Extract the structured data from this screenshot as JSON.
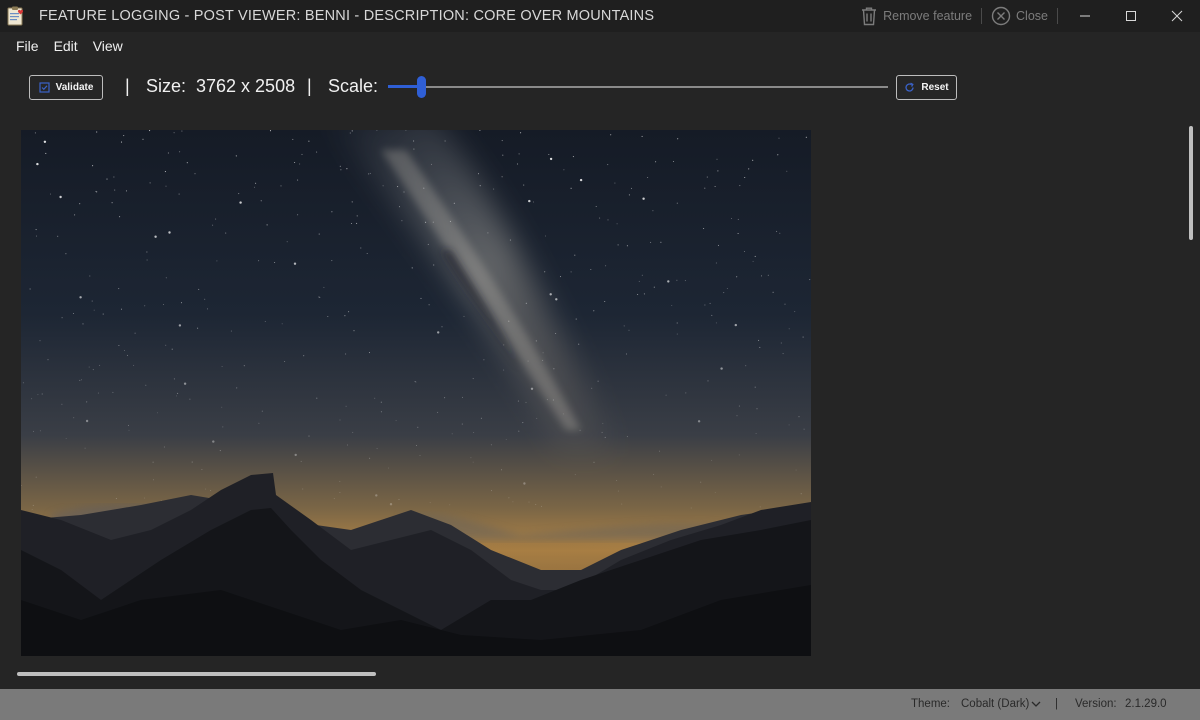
{
  "window": {
    "title": "FEATURE LOGGING - POST VIEWER: BENNI - DESCRIPTION: CORE OVER MOUNTAINS",
    "actions": {
      "remove_feature": "Remove feature",
      "close": "Close"
    }
  },
  "menu": {
    "file": "File",
    "edit": "Edit",
    "view": "View"
  },
  "toolbar": {
    "validate_label": "Validate",
    "separator": "|",
    "size_label": "Size:",
    "size_value": "3762 x 2508",
    "scale_label": "Scale:",
    "scale_slider_fraction": 0.065,
    "reset_label": "Reset"
  },
  "status": {
    "theme_label": "Theme:",
    "theme_value": "Cobalt (Dark)",
    "separator": "|",
    "version_label": "Version:",
    "version_value": "2.1.29.0"
  },
  "colors": {
    "accent": "#2f5fd6",
    "window_bg": "#252525",
    "statusbar_bg": "#7a7a7a"
  }
}
